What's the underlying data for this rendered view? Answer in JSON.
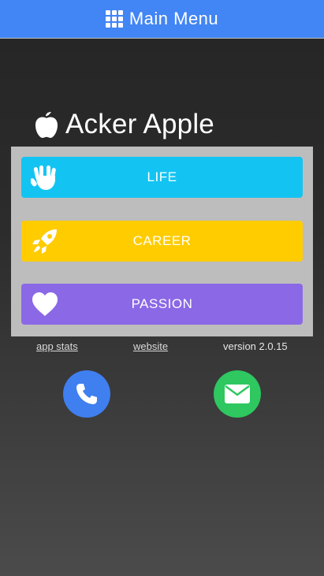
{
  "header": {
    "title": "Main Menu",
    "icon": "grid-icon",
    "color": "#4285f4"
  },
  "brand": {
    "name": "Acker Apple",
    "icon": "apple-icon"
  },
  "menu": {
    "items": [
      {
        "label": "LIFE",
        "icon": "hand-icon",
        "color": "#13c4f2"
      },
      {
        "label": "CAREER",
        "icon": "rocket-icon",
        "color": "#ffcc00"
      },
      {
        "label": "PASSION",
        "icon": "heart-icon",
        "color": "#8b68e6"
      }
    ]
  },
  "footer": {
    "app_stats": "app stats",
    "website": "website",
    "version": "version 2.0.15"
  },
  "contact": {
    "phone_icon": "phone-icon",
    "phone_color": "#3f7ff0",
    "mail_icon": "envelope-icon",
    "mail_color": "#2ec760"
  }
}
